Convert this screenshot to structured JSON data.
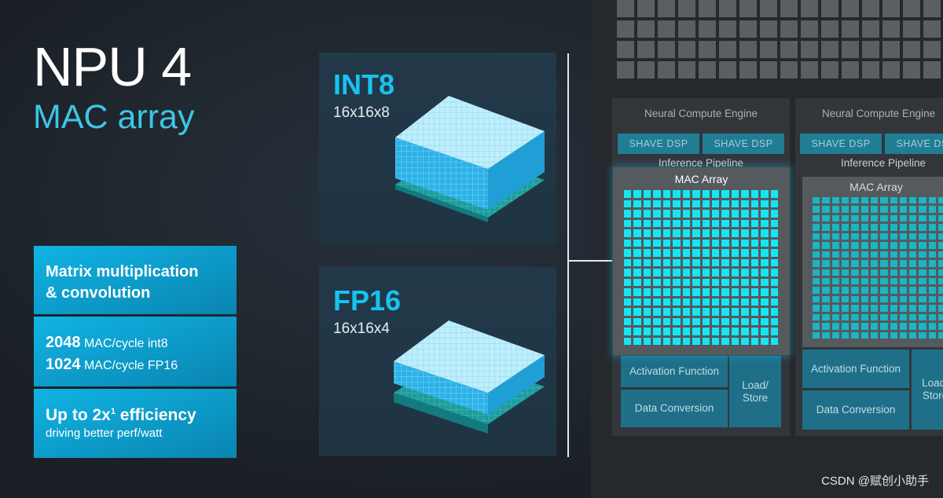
{
  "title": "NPU 4",
  "subtitle": "MAC array",
  "features": [
    {
      "line1": "Matrix multiplication",
      "line2": "& convolution"
    },
    {
      "n1": "2048",
      "t1": "MAC/cycle int8",
      "n2": "1024",
      "t2": "MAC/cycle FP16"
    },
    {
      "head_pre": "Up to 2x",
      "sup": "1",
      "head_post": " efficiency",
      "sub": "driving better perf/watt"
    }
  ],
  "panels": [
    {
      "label": "INT8",
      "dims": "16x16x8"
    },
    {
      "label": "FP16",
      "dims": "16x16x4"
    }
  ],
  "engines": [
    {
      "title": "Neural Compute Engine",
      "dsp": [
        "SHAVE DSP",
        "SHAVE DSP"
      ],
      "pipeline": "Inference Pipeline",
      "mac": "MAC Array",
      "activation": "Activation Function",
      "load_store": "Load/ Store",
      "conversion": "Data Conversion"
    },
    {
      "title": "Neural Compute Engine",
      "dsp": [
        "SHAVE DSP",
        "SHAVE DSP"
      ],
      "pipeline": "Inference Pipeline",
      "mac": "MAC Array",
      "activation": "Activation Function",
      "load_store": "Load/ Store",
      "conversion": "Data Conversion"
    }
  ],
  "watermark": "CSDN @赋创小助手",
  "colors": {
    "accent": "#16c3f0",
    "feature_box": "#0e9fcf",
    "mac_cell": "#16e6f4"
  }
}
